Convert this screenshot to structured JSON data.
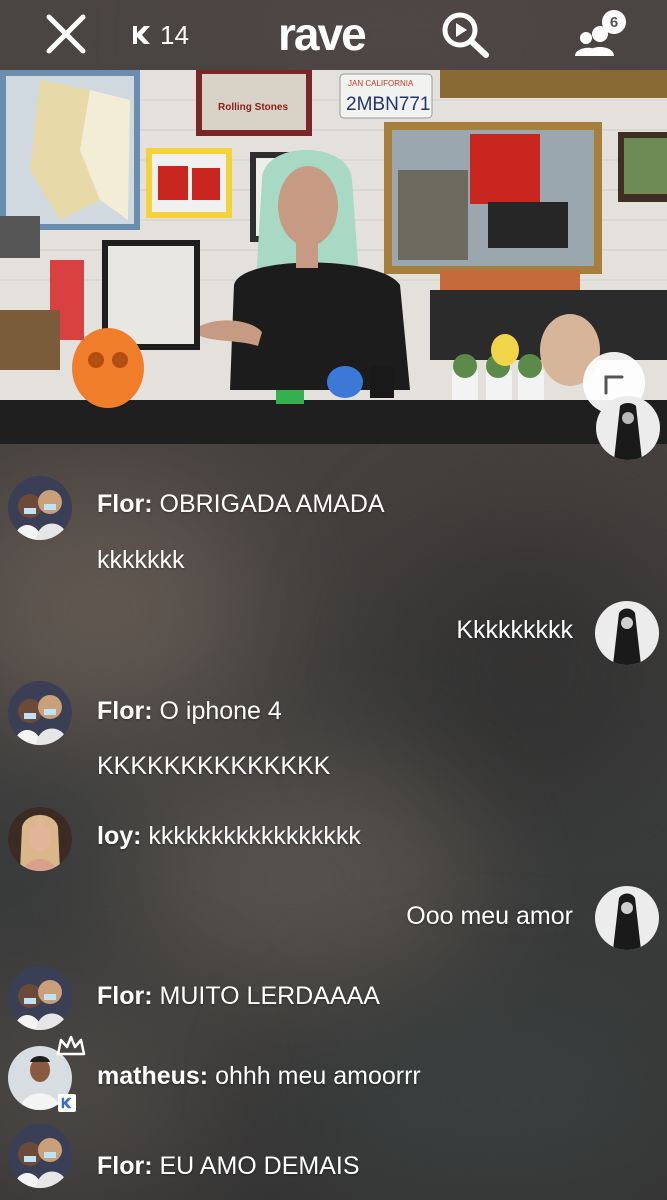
{
  "header": {
    "close_icon": "close-icon",
    "member_count": "14",
    "logo_text": "rave",
    "search_icon": "search-play-icon",
    "users_icon": "users-icon",
    "users_badge": "6"
  },
  "video": {
    "license_plate_top": "JAN  CALIFORNIA",
    "license_plate": "2MBN771",
    "poster_text": "Rolling Stones",
    "minimize_icon": "minimize-icon"
  },
  "chat": {
    "messages": [
      {
        "user": "Flor:",
        "text": "OBRIGADA AMADA"
      },
      {
        "user": "",
        "text": "kkkkkkk"
      },
      {
        "user": "",
        "text": "Kkkkkkkkk"
      },
      {
        "user": "Flor:",
        "text": "O iphone 4"
      },
      {
        "user": "",
        "text": "KKKKKKKKKKKKKK"
      },
      {
        "user": "loy:",
        "text": "kkkkkkkkkkkkkkkkk"
      },
      {
        "user": "",
        "text": "Ooo meu amor"
      },
      {
        "user": "Flor:",
        "text": "MUITO LERDAAAA"
      },
      {
        "user": "matheus:",
        "text": "ohhh meu amoorrr"
      },
      {
        "user": "Flor:",
        "text": "EU AMO DEMAIS"
      }
    ]
  },
  "colors": {
    "accent": "#ffffff",
    "video_bg": "#d9d6d2"
  }
}
